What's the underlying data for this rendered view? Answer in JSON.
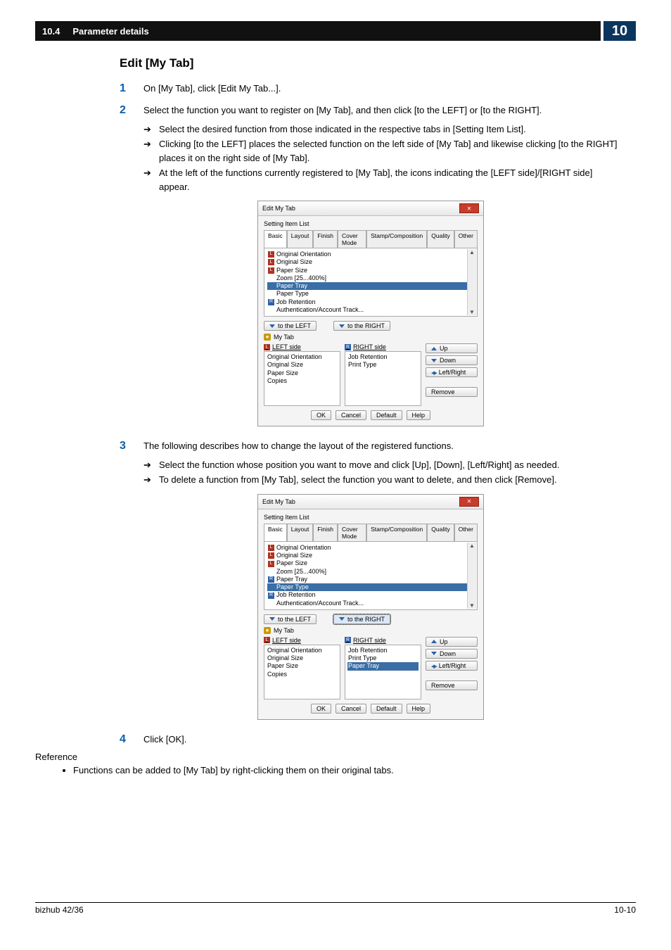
{
  "header": {
    "sectionNumber": "10.4",
    "sectionTitle": "Parameter details",
    "chapterNumber": "10"
  },
  "section": {
    "title": "Edit [My Tab]"
  },
  "steps": {
    "s1": {
      "num": "1",
      "text": "On [My Tab], click [Edit My Tab...]."
    },
    "s2": {
      "num": "2",
      "text": "Select the function you want to register on [My Tab], and then click [to the LEFT] or [to the RIGHT].",
      "sub1": "Select the desired function from those indicated in the respective tabs in [Setting Item List].",
      "sub2": "Clicking [to the LEFT] places the selected function on the left side of [My Tab] and likewise clicking [to the RIGHT] places it on the right side of [My Tab].",
      "sub3": "At the left of the functions currently registered to [My Tab], the icons indicating the [LEFT side]/[RIGHT side] appear."
    },
    "s3": {
      "num": "3",
      "text": "The following describes how to change the layout of the registered functions.",
      "sub1": "Select the function whose position you want to move and click [Up], [Down], [Left/Right] as needed.",
      "sub2": "To delete a function from [My Tab], select the function you want to delete, and then click [Remove]."
    },
    "s4": {
      "num": "4",
      "text": "Click [OK]."
    }
  },
  "dialog": {
    "title": "Edit My Tab",
    "groupLabel": "Setting Item List",
    "tabs": {
      "basic": "Basic",
      "layout": "Layout",
      "finish": "Finish",
      "cover": "Cover Mode",
      "stamp": "Stamp/Composition",
      "quality": "Quality",
      "other": "Other"
    },
    "items": {
      "orient": "Original Orientation",
      "osize": "Original Size",
      "psize": "Paper Size",
      "zoom": "Zoom [25...400%]",
      "ptray": "Paper Tray",
      "ptype": "Paper Type",
      "jobret": "Job Retention",
      "auth": "Authentication/Account Track..."
    },
    "buttons": {
      "toLeft": "to the LEFT",
      "toRight": "to the RIGHT",
      "up": "Up",
      "down": "Down",
      "lr": "Left/Right",
      "remove": "Remove",
      "ok": "OK",
      "cancel": "Cancel",
      "default": "Default",
      "help": "Help"
    },
    "myTabLabel": "My Tab",
    "leftHeader": "LEFT side",
    "rightHeader": "RIGHT side",
    "left": {
      "i1": "Original Orientation",
      "i2": "Original Size",
      "i3": "Paper Size",
      "i4": "Copies"
    },
    "rightA": {
      "i1": "Job Retention",
      "i2": "Print Type"
    },
    "rightB": {
      "i1": "Job Retention",
      "i2": "Print Type",
      "i3": "Paper Tray"
    }
  },
  "reference": {
    "heading": "Reference",
    "b1": "Functions can be added to [My Tab] by right-clicking them on their original tabs."
  },
  "footer": {
    "left": "bizhub 42/36",
    "right": "10-10"
  }
}
